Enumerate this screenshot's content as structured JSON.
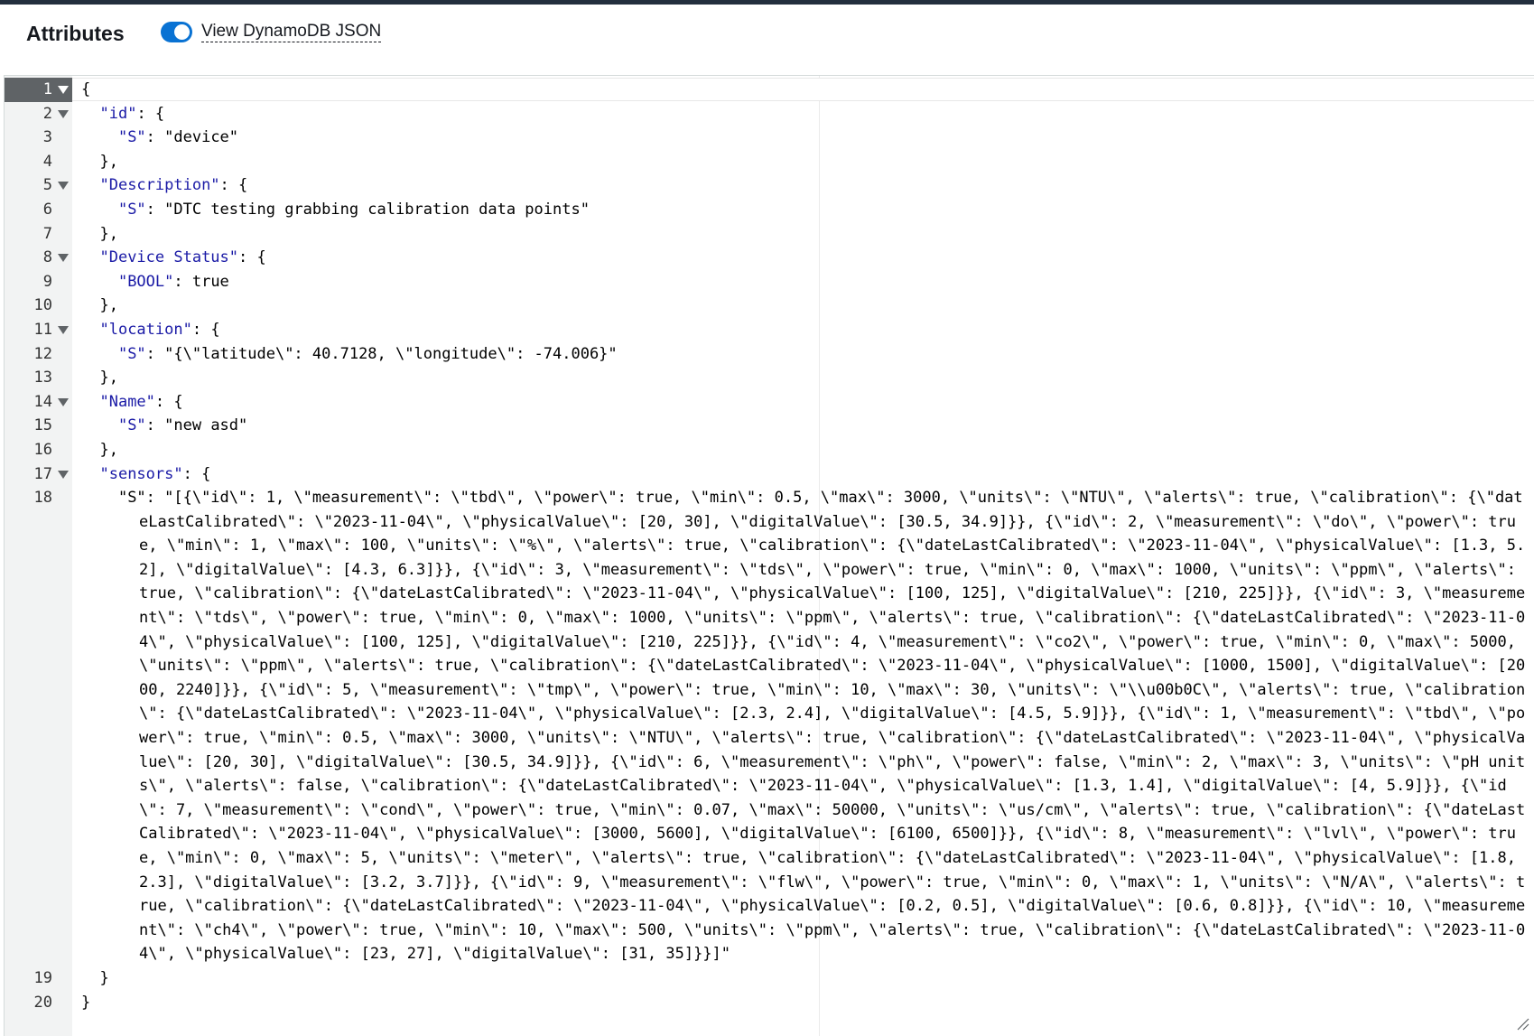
{
  "panel": {
    "title": "Attributes",
    "toggle_label": "View DynamoDB JSON",
    "toggle_on": true
  },
  "colors": {
    "toggle_on": "#0972d3",
    "key": "#1a1aa6",
    "bool": "#c41a16"
  },
  "editor": {
    "lines": [
      {
        "n": "1",
        "fold": true,
        "active": true,
        "text": "{"
      },
      {
        "n": "2",
        "fold": true,
        "text": "  \"id\": {"
      },
      {
        "n": "3",
        "text": "    \"S\": \"device\""
      },
      {
        "n": "4",
        "text": "  },"
      },
      {
        "n": "5",
        "fold": true,
        "text": "  \"Description\": {"
      },
      {
        "n": "6",
        "text": "    \"S\": \"DTC testing grabbing calibration data points\""
      },
      {
        "n": "7",
        "text": "  },"
      },
      {
        "n": "8",
        "fold": true,
        "text": "  \"Device Status\": {"
      },
      {
        "n": "9",
        "text": "    \"BOOL\": true"
      },
      {
        "n": "10",
        "text": "  },"
      },
      {
        "n": "11",
        "fold": true,
        "text": "  \"location\": {"
      },
      {
        "n": "12",
        "text": "    \"S\": \"{\\\"latitude\\\": 40.7128, \\\"longitude\\\": -74.006}\""
      },
      {
        "n": "13",
        "text": "  },"
      },
      {
        "n": "14",
        "fold": true,
        "text": "  \"Name\": {"
      },
      {
        "n": "15",
        "text": "    \"S\": \"new asd\""
      },
      {
        "n": "16",
        "text": "  },"
      },
      {
        "n": "17",
        "fold": true,
        "text": "  \"sensors\": {"
      },
      {
        "n": "18",
        "wrap": true,
        "text": "    \"S\": \"[{\\\"id\\\": 1, \\\"measurement\\\": \\\"tbd\\\", \\\"power\\\": true, \\\"min\\\": 0.5, \\\"max\\\": 3000, \\\"units\\\": \\\"NTU\\\", \\\"alerts\\\": true, \\\"calibration\\\": {\\\"dateLastCalibrated\\\": \\\"2023-11-04\\\", \\\"physicalValue\\\": [20, 30], \\\"digitalValue\\\": [30.5, 34.9]}}, {\\\"id\\\": 2, \\\"measurement\\\": \\\"do\\\", \\\"power\\\": true, \\\"min\\\": 1, \\\"max\\\": 100, \\\"units\\\": \\\"%\\\", \\\"alerts\\\": true, \\\"calibration\\\": {\\\"dateLastCalibrated\\\": \\\"2023-11-04\\\", \\\"physicalValue\\\": [1.3, 5.2], \\\"digitalValue\\\": [4.3, 6.3]}}, {\\\"id\\\": 3, \\\"measurement\\\": \\\"tds\\\", \\\"power\\\": true, \\\"min\\\": 0, \\\"max\\\": 1000, \\\"units\\\": \\\"ppm\\\", \\\"alerts\\\": true, \\\"calibration\\\": {\\\"dateLastCalibrated\\\": \\\"2023-11-04\\\", \\\"physicalValue\\\": [100, 125], \\\"digitalValue\\\": [210, 225]}}, {\\\"id\\\": 3, \\\"measurement\\\": \\\"tds\\\", \\\"power\\\": true, \\\"min\\\": 0, \\\"max\\\": 1000, \\\"units\\\": \\\"ppm\\\", \\\"alerts\\\": true, \\\"calibration\\\": {\\\"dateLastCalibrated\\\": \\\"2023-11-04\\\", \\\"physicalValue\\\": [100, 125], \\\"digitalValue\\\": [210, 225]}}, {\\\"id\\\": 4, \\\"measurement\\\": \\\"co2\\\", \\\"power\\\": true, \\\"min\\\": 0, \\\"max\\\": 5000, \\\"units\\\": \\\"ppm\\\", \\\"alerts\\\": true, \\\"calibration\\\": {\\\"dateLastCalibrated\\\": \\\"2023-11-04\\\", \\\"physicalValue\\\": [1000, 1500], \\\"digitalValue\\\": [2000, 2240]}}, {\\\"id\\\": 5, \\\"measurement\\\": \\\"tmp\\\", \\\"power\\\": true, \\\"min\\\": 10, \\\"max\\\": 30, \\\"units\\\": \\\"\\\\u00b0C\\\", \\\"alerts\\\": true, \\\"calibration\\\": {\\\"dateLastCalibrated\\\": \\\"2023-11-04\\\", \\\"physicalValue\\\": [2.3, 2.4], \\\"digitalValue\\\": [4.5, 5.9]}}, {\\\"id\\\": 1, \\\"measurement\\\": \\\"tbd\\\", \\\"power\\\": true, \\\"min\\\": 0.5, \\\"max\\\": 3000, \\\"units\\\": \\\"NTU\\\", \\\"alerts\\\": true, \\\"calibration\\\": {\\\"dateLastCalibrated\\\": \\\"2023-11-04\\\", \\\"physicalValue\\\": [20, 30], \\\"digitalValue\\\": [30.5, 34.9]}}, {\\\"id\\\": 6, \\\"measurement\\\": \\\"ph\\\", \\\"power\\\": false, \\\"min\\\": 2, \\\"max\\\": 3, \\\"units\\\": \\\"pH units\\\", \\\"alerts\\\": false, \\\"calibration\\\": {\\\"dateLastCalibrated\\\": \\\"2023-11-04\\\", \\\"physicalValue\\\": [1.3, 1.4], \\\"digitalValue\\\": [4, 5.9]}}, {\\\"id\\\": 7, \\\"measurement\\\": \\\"cond\\\", \\\"power\\\": true, \\\"min\\\": 0.07, \\\"max\\\": 50000, \\\"units\\\": \\\"us/cm\\\", \\\"alerts\\\": true, \\\"calibration\\\": {\\\"dateLastCalibrated\\\": \\\"2023-11-04\\\", \\\"physicalValue\\\": [3000, 5600], \\\"digitalValue\\\": [6100, 6500]}}, {\\\"id\\\": 8, \\\"measurement\\\": \\\"lvl\\\", \\\"power\\\": true, \\\"min\\\": 0, \\\"max\\\": 5, \\\"units\\\": \\\"meter\\\", \\\"alerts\\\": true, \\\"calibration\\\": {\\\"dateLastCalibrated\\\": \\\"2023-11-04\\\", \\\"physicalValue\\\": [1.8, 2.3], \\\"digitalValue\\\": [3.2, 3.7]}}, {\\\"id\\\": 9, \\\"measurement\\\": \\\"flw\\\", \\\"power\\\": true, \\\"min\\\": 0, \\\"max\\\": 1, \\\"units\\\": \\\"N/A\\\", \\\"alerts\\\": true, \\\"calibration\\\": {\\\"dateLastCalibrated\\\": \\\"2023-11-04\\\", \\\"physicalValue\\\": [0.2, 0.5], \\\"digitalValue\\\": [0.6, 0.8]}}, {\\\"id\\\": 10, \\\"measurement\\\": \\\"ch4\\\", \\\"power\\\": true, \\\"min\\\": 10, \\\"max\\\": 500, \\\"units\\\": \\\"ppm\\\", \\\"alerts\\\": true, \\\"calibration\\\": {\\\"dateLastCalibrated\\\": \\\"2023-11-04\\\", \\\"physicalValue\\\": [23, 27], \\\"digitalValue\\\": [31, 35]}}]\""
      },
      {
        "n": "19",
        "text": "  }"
      },
      {
        "n": "20",
        "text": "}"
      }
    ]
  }
}
